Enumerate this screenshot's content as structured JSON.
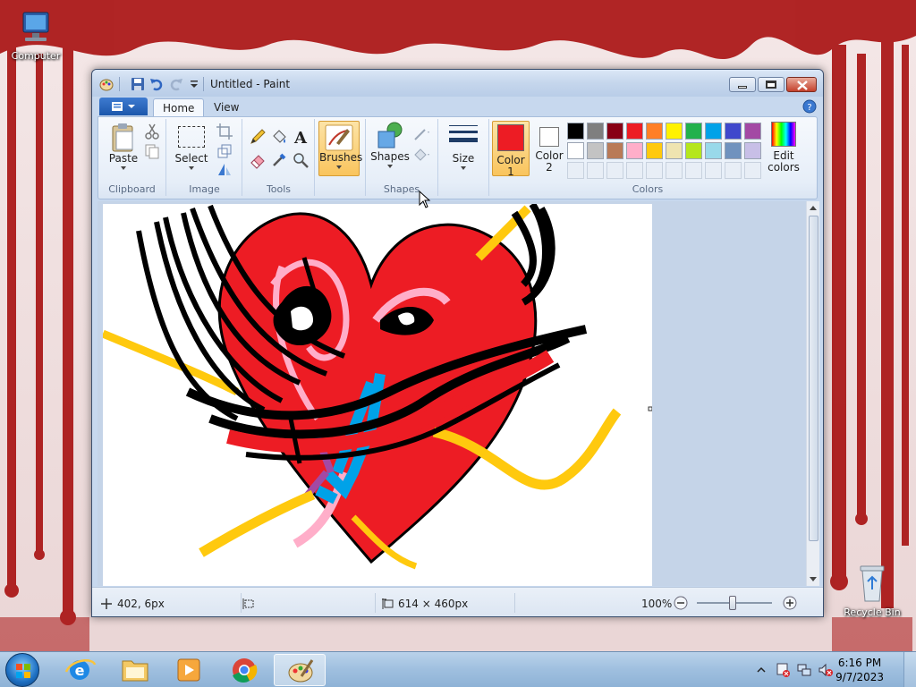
{
  "desktop": {
    "icons": [
      {
        "label": "Computer",
        "icon": "computer-icon"
      },
      {
        "label": "Recycle Bin",
        "icon": "recycle-bin-icon"
      }
    ]
  },
  "window": {
    "title": "Untitled - Paint",
    "tabs": [
      {
        "label": "Home",
        "active": true
      },
      {
        "label": "View",
        "active": false
      }
    ],
    "ribbon": {
      "groups": {
        "clipboard": "Clipboard",
        "image": "Image",
        "tools": "Tools",
        "shapes": "Shapes",
        "colors": "Colors"
      },
      "buttons": {
        "paste": "Paste",
        "select": "Select",
        "brushes": "Brushes",
        "shapes": "Shapes",
        "size": "Size",
        "color1_line1": "Color",
        "color1_line2": "1",
        "color2_line1": "Color",
        "color2_line2": "2",
        "edit_colors_line1": "Edit",
        "edit_colors_line2": "colors"
      },
      "color1": "#ed1c24",
      "color2": "#ffffff",
      "palette": [
        "#000000",
        "#7f7f7f",
        "#880015",
        "#ed1c24",
        "#ff7f27",
        "#fff200",
        "#22b14c",
        "#00a2e8",
        "#3f48cc",
        "#a349a4",
        "#ffffff",
        "#c3c3c3",
        "#b97a57",
        "#ffaec9",
        "#ffc90e",
        "#efe4b0",
        "#b5e61d",
        "#99d9ea",
        "#7092be",
        "#c8bfe7"
      ]
    },
    "status": {
      "cursor_pos": "402, 6px",
      "image_size": "614 × 460px",
      "zoom": "100%"
    }
  },
  "taskbar": {
    "time": "6:16 PM",
    "date": "9/7/2023"
  }
}
